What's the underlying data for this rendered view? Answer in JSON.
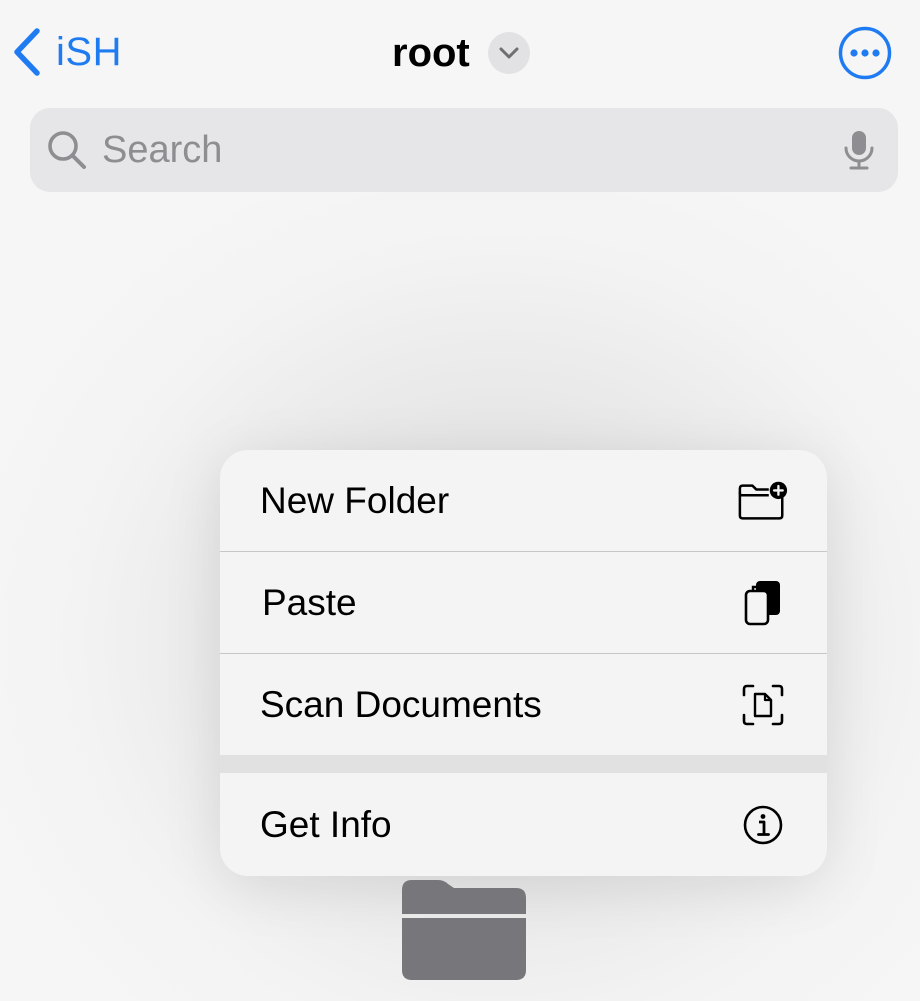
{
  "nav": {
    "back_label": "iSH",
    "title": "root",
    "more_icon": "ellipsis-circle-icon"
  },
  "search": {
    "value": "",
    "placeholder": "Search"
  },
  "context_menu": {
    "items": [
      {
        "label": "New Folder",
        "icon": "folder-badge-plus-icon"
      },
      {
        "label": "Paste",
        "icon": "doc-on-clipboard-icon"
      },
      {
        "label": "Scan Documents",
        "icon": "doc-viewfinder-icon"
      },
      {
        "label": "Get Info",
        "icon": "info-circle-icon"
      }
    ]
  },
  "colors": {
    "accent": "#1f7bf2",
    "folder": "#76767b",
    "background": "#f2f2f2"
  }
}
